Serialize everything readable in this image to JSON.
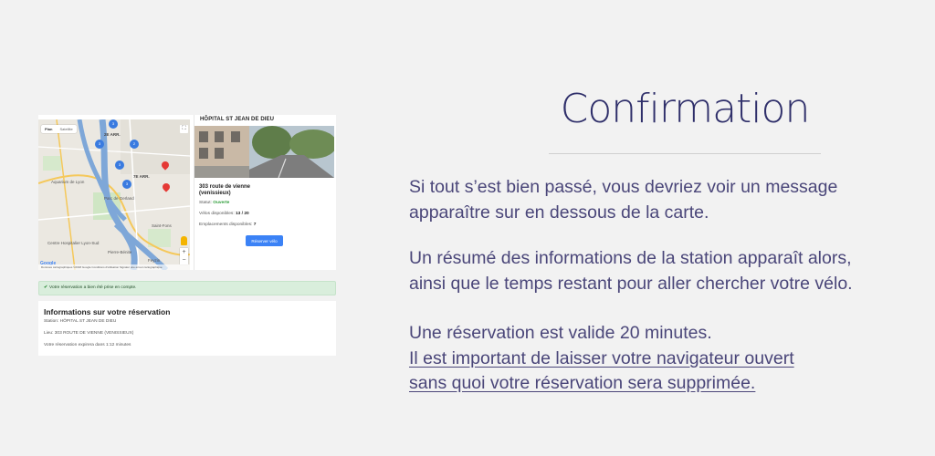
{
  "map": {
    "type_plan": "Plan",
    "type_satellite": "Satellite",
    "labels": [
      "2E ARR.",
      "7E ARR.",
      "Aquarium de Lyon",
      "Parc de Gerland",
      "Centre Hospitalier Lyon-Sud",
      "Pierre-Bénite",
      "Feyzin",
      "Saint-Fons"
    ],
    "footer": "Données cartographiques ©2018 Google   Conditions d'utilisation   Signaler une erreur cartographique",
    "clusters": [
      "3",
      "3",
      "2",
      "3",
      "3"
    ],
    "logo": "Google"
  },
  "station": {
    "name": "HÔPITAL ST JEAN DE DIEU",
    "address_line1": "303 route de vienne",
    "address_line2": "(venissieux)",
    "status_label": "Statut:",
    "status_value": "Ouverte",
    "bikes_label": "Vélos disponibles:",
    "bikes_value": "13 / 20",
    "slots_label": "Emplacements disponibles:",
    "slots_value": "7",
    "reserve_button": "Réserver vélo"
  },
  "alert": {
    "message": "Votre réservation a bien été prise en compte."
  },
  "resume": {
    "title": "Informations sur votre réservation",
    "station_line": "Station: HÔPITAL ST JEAN DE DIEU",
    "place_line": "Lieu: 303 ROUTE DE VIENNE (VENISSIEUX)",
    "expiry_line": "Votre réservation expirera dans 1:12 minutes"
  },
  "explanation": {
    "heading": "Confirmation",
    "p1_line1": "Si tout s’est bien passé, vous devriez voir un message",
    "p1_line2": "apparaître sur en dessous de la carte.",
    "p2_line1": "Un résumé des informations de la station apparaît alors,",
    "p2_line2": "ainsi que le temps restant pour aller chercher votre vélo.",
    "p3_line1": "Une réservation est valide 20 minutes.",
    "p3_line2": "Il est important de laisser votre navigateur ouvert",
    "p3_line3": "sans quoi votre réservation sera supprimée."
  },
  "colors": {
    "text_accent": "#4a4679",
    "heading": "#2f2f6a",
    "button": "#3b82f6",
    "alert_bg": "#d9eedc",
    "status_open": "#2e9d3a"
  }
}
